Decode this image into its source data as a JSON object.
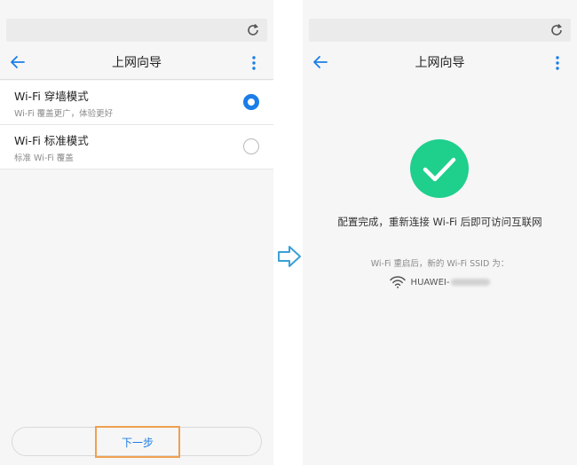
{
  "left_screen": {
    "title": "上网向导",
    "options": [
      {
        "title": "Wi-Fi 穿墙模式",
        "subtitle": "Wi-Fi 覆盖更广，体验更好",
        "selected": true
      },
      {
        "title": "Wi-Fi 标准模式",
        "subtitle": "标准 Wi-Fi 覆盖",
        "selected": false
      }
    ],
    "next_label": "下一步"
  },
  "right_screen": {
    "title": "上网向导",
    "success_message": "配置完成，重新连接 Wi-Fi 后即可访问互联网",
    "ssid_caption": "Wi-Fi 重启后，新的 Wi-Fi SSID 为：",
    "ssid_prefix": "HUAWEI-"
  },
  "icons": {
    "refresh": "refresh-icon",
    "back": "back-arrow-icon",
    "more": "more-vertical-icon",
    "transition": "right-arrow-icon",
    "success": "checkmark-circle-icon",
    "wifi": "wifi-icon"
  },
  "colors": {
    "accent": "#1a7de8",
    "success": "#1fcf8c",
    "highlight_border": "#f0a050",
    "transition_arrow": "#3aa0d8"
  }
}
